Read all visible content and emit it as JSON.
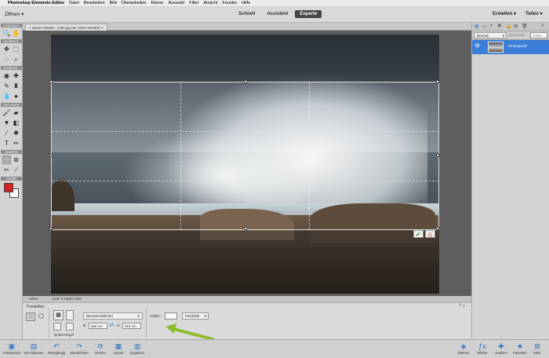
{
  "menubar": {
    "app": "Photoshop Elements Editor",
    "items": [
      "Datei",
      "Bearbeiten",
      "Bild",
      "Überarbeiten",
      "Ebene",
      "Auswahl",
      "Filter",
      "Ansicht",
      "Fenster",
      "Hilfe"
    ]
  },
  "header": {
    "open_label": "Öffnen",
    "modes": [
      "Schnell",
      "Assistent",
      "Experte"
    ],
    "active_mode": "Experte",
    "create_label": "Erstellen",
    "share_label": "Teilen"
  },
  "toolbox": {
    "sections": [
      "ANZEIGEN",
      "AUSWAHL",
      "VERBESS...",
      "ZEICHNEN",
      "ÄNDERN",
      "FARBE"
    ],
    "colors": {
      "foreground": "#d42020",
      "background": "#ffffff"
    }
  },
  "document": {
    "tab_label": "waves-325567_1280.jpg bei 100% (RGB/8)"
  },
  "status": {
    "zoom": "100%",
    "doc_size": "Dok: 3,12M/3,12M"
  },
  "tool_options": {
    "title": "Freistellen",
    "ratio_preset": "Benutzerdefiniert",
    "width_label": "B:",
    "width_value": "626 cm",
    "height_label": "H:",
    "height_value": "315 cm",
    "grid_label": "Drittel-Regel",
    "resolution_label": "Auflös.:",
    "resolution_unit": "Pixel/Zoll"
  },
  "layers_panel": {
    "blend_mode": "Normal",
    "opacity_label": "Deckkraft:",
    "opacity_value": "100%",
    "layer_name": "Hintergrund"
  },
  "bottombar": {
    "left": [
      "Fotobereich",
      "WZ-Optionen",
      "Rückgängig",
      "Wiederholen",
      "Drehen",
      "Layout",
      "Organizer"
    ],
    "right": [
      "Ebenen",
      "Effekte",
      "Grafiken",
      "Favoriten",
      "Mehr"
    ]
  },
  "colors": {
    "accent": "#3a7ed8",
    "arrow": "#8cbd2e"
  }
}
